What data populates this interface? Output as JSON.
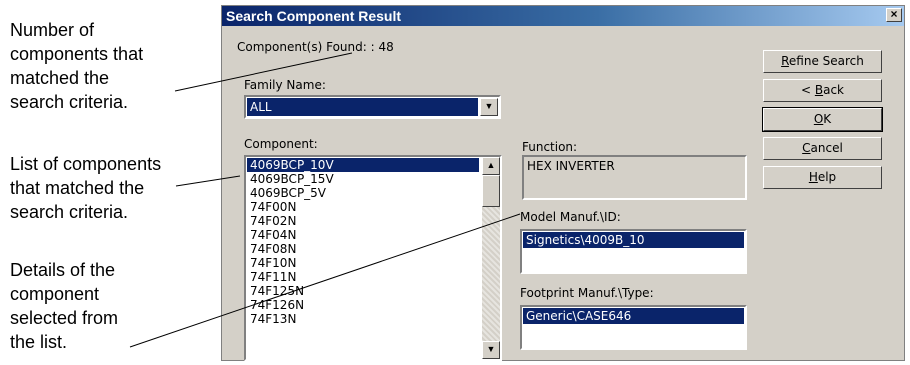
{
  "annotations": {
    "count_note": [
      "Number of",
      "components that",
      "matched the",
      "search criteria."
    ],
    "list_note": [
      "List of components",
      "that matched the",
      "search criteria."
    ],
    "details_note": [
      "Details of the",
      "component",
      "selected from",
      "the list."
    ]
  },
  "dialog": {
    "title": "Search Component Result",
    "close_glyph": "×",
    "found_label": "Component(s) Found: : 48"
  },
  "family": {
    "label": "Family Name:",
    "value": "ALL"
  },
  "component_list": {
    "label": "Component:",
    "items": [
      "4069BCP_10V",
      "4069BCP_15V",
      "4069BCP_5V",
      "74F00N",
      "74F02N",
      "74F04N",
      "74F08N",
      "74F10N",
      "74F11N",
      "74F125N",
      "74F126N",
      "74F13N"
    ],
    "selected_index": 0
  },
  "function": {
    "label": "Function:",
    "value": "HEX INVERTER"
  },
  "model": {
    "label": "Model Manuf.\\ID:",
    "value": "Signetics\\4009B_10"
  },
  "footprint": {
    "label": "Footprint Manuf.\\Type:",
    "value": "Generic\\CASE646"
  },
  "buttons": {
    "refine": {
      "key": "R",
      "rest": "efine Search"
    },
    "back": {
      "pre": "< ",
      "key": "B",
      "rest": "ack"
    },
    "ok": {
      "key": "O",
      "rest": "K"
    },
    "cancel": {
      "key": "C",
      "rest": "ancel"
    },
    "help": {
      "key": "H",
      "rest": "elp"
    }
  },
  "icons": {
    "scroll_up": "▲",
    "scroll_down": "▼",
    "dropdown": "▼"
  }
}
